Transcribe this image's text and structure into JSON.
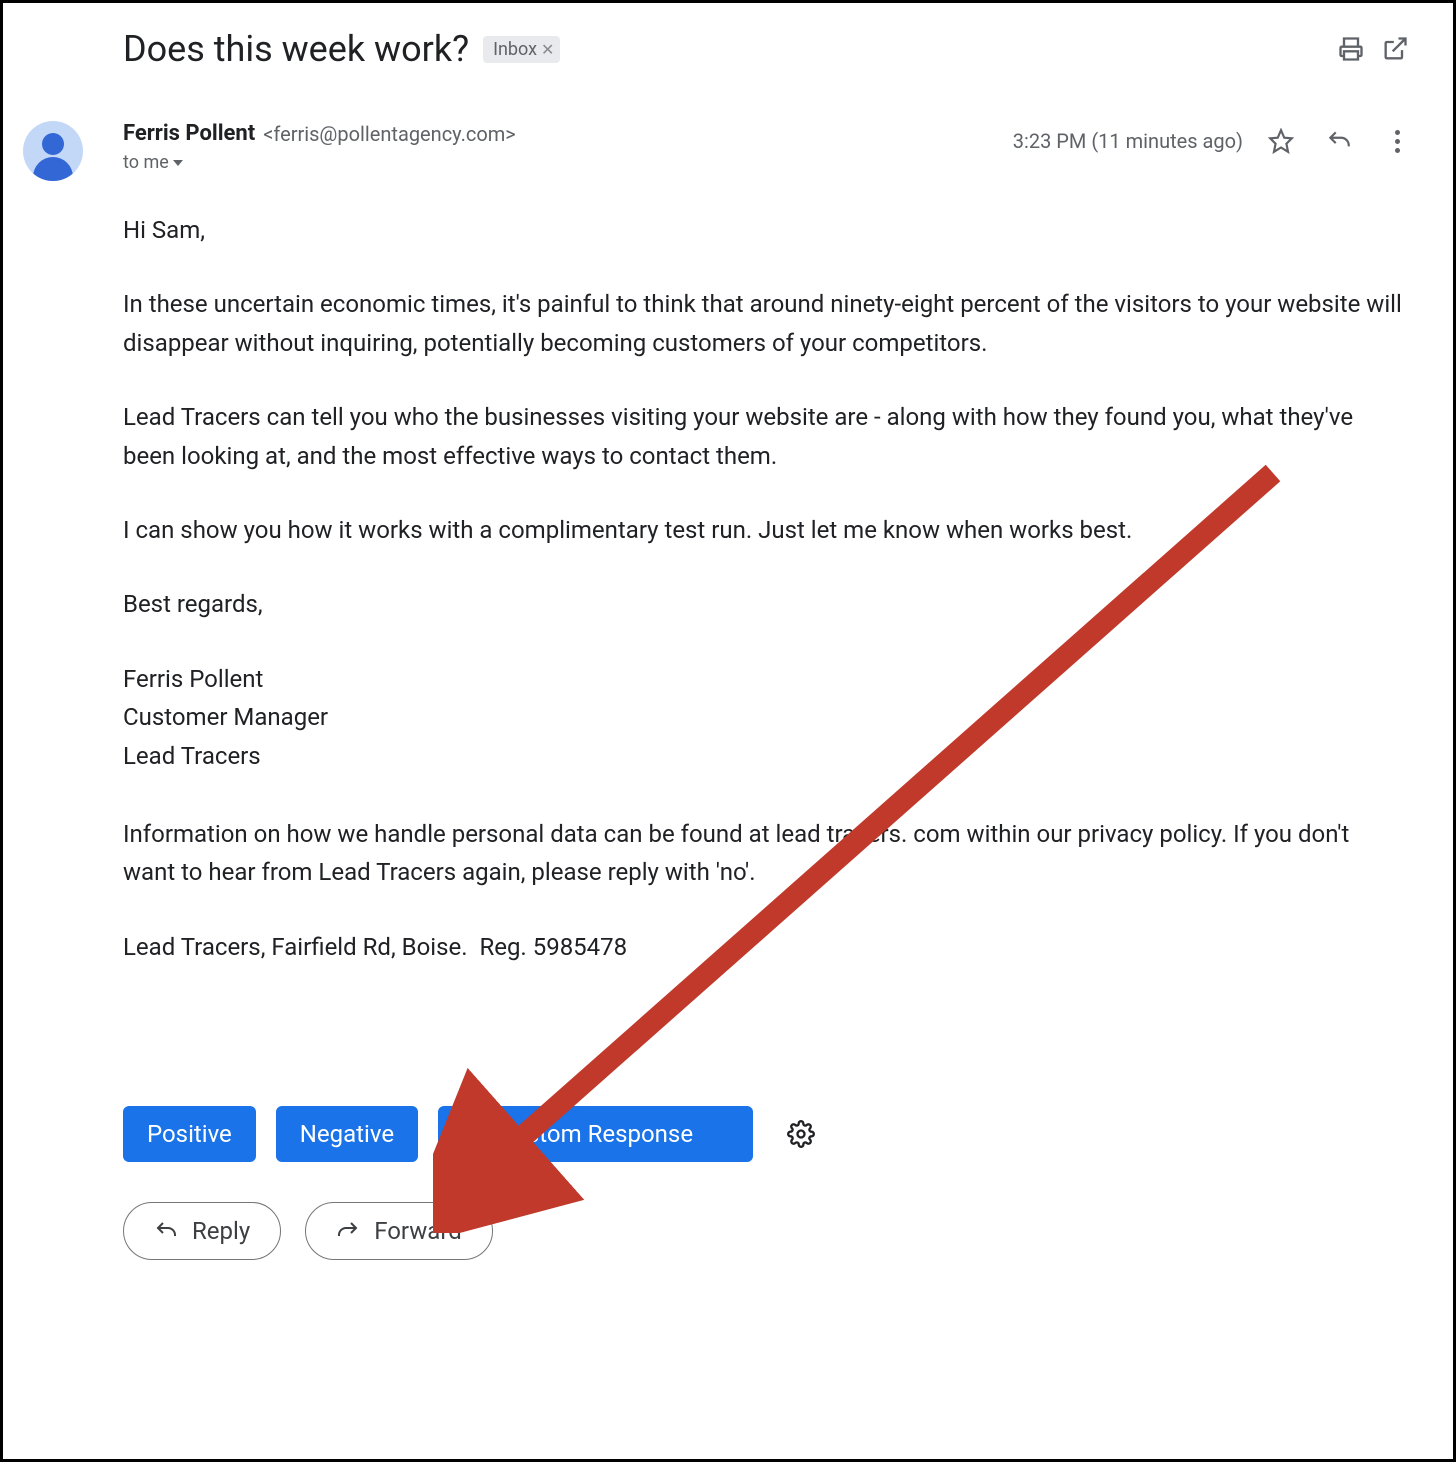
{
  "header": {
    "subject": "Does this week work?",
    "label": "Inbox"
  },
  "sender": {
    "name": "Ferris Pollent",
    "email": "<ferris@pollentagency.com>",
    "to": "to me",
    "timestamp": "3:23 PM (11 minutes ago)"
  },
  "body": {
    "greet": "Hi Sam,",
    "p1": "In these uncertain economic times, it's painful to think that around ninety-eight percent of the visitors to your website will disappear without inquiring, potentially becoming customers of your competitors.",
    "p2": "Lead Tracers can tell you who the businesses visiting your website are - along with how they found you, what they've been looking at, and the most effective ways to contact them.",
    "p3": "I can show you how it works with a complimentary test run. Just let me know when works best.",
    "sign1": "Best regards,",
    "sign2": "Ferris Pollent",
    "sign3": "Customer Manager",
    "sign4": "Lead Tracers",
    "footer1": "Information on how we handle personal data can be found at lead tracers. com within our privacy policy. If you don't want to hear from Lead Tracers again, please reply with 'no'.",
    "footer2": "Lead Tracers, Fairfield Rd, Boise.  Reg. 5985478"
  },
  "actions": {
    "positive": "Positive",
    "negative": "Negative",
    "custom": "Custom Response"
  },
  "rf": {
    "reply": "Reply",
    "forward": "Forward"
  }
}
